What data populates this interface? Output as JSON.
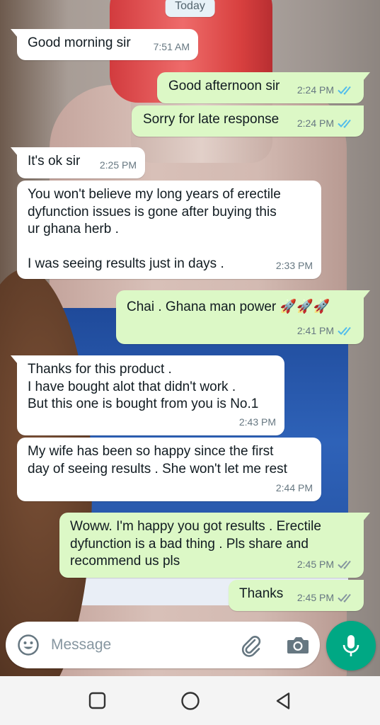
{
  "date_separator": "Today",
  "messages": [
    {
      "direction": "in",
      "text": "Good morning sir",
      "time": "7:51 AM"
    },
    {
      "direction": "out",
      "text": "Good afternoon sir",
      "time": "2:24 PM",
      "status": "read"
    },
    {
      "direction": "out",
      "text": "Sorry for late response",
      "time": "2:24 PM",
      "status": "read"
    },
    {
      "direction": "in",
      "text": "It's ok sir",
      "time": "2:25 PM"
    },
    {
      "direction": "in",
      "text": "You won't believe my long years of erectile\ndyfunction issues is gone after buying this\nur ghana herb .\n\nI was seeing results just in days .",
      "time": "2:33 PM"
    },
    {
      "direction": "out",
      "text": "Chai . Ghana man power",
      "emoji": "🚀🚀🚀",
      "time": "2:41 PM",
      "status": "read"
    },
    {
      "direction": "in",
      "text": "Thanks for this product .\nI have bought alot that didn't work .\nBut this one is bought from you is No.1",
      "time": "2:43 PM"
    },
    {
      "direction": "in",
      "text": "My wife has been so happy since the first\nday of seeing results . She won't let me rest",
      "time": "2:44 PM"
    },
    {
      "direction": "out",
      "text": "Woww. I'm happy you got results . Erectile\ndyfunction is a bad thing . Pls share and\nrecommend us pls",
      "time": "2:45 PM",
      "status": "delivered"
    },
    {
      "direction": "out",
      "text": "Thanks",
      "time": "2:45 PM",
      "status": "delivered"
    }
  ],
  "input": {
    "placeholder": "Message",
    "value": ""
  },
  "icons": {
    "emoji": "emoji-icon",
    "attach": "paperclip-icon",
    "camera": "camera-icon",
    "mic": "mic-icon",
    "nav_recent": "recents-square-icon",
    "nav_home": "home-circle-icon",
    "nav_back": "back-triangle-icon"
  },
  "colors": {
    "outgoing_bubble": "#dcf8c6",
    "incoming_bubble": "#ffffff",
    "read_ticks": "#53bdeb",
    "delivered_ticks": "#8696a0",
    "mic_button": "#00a884"
  }
}
